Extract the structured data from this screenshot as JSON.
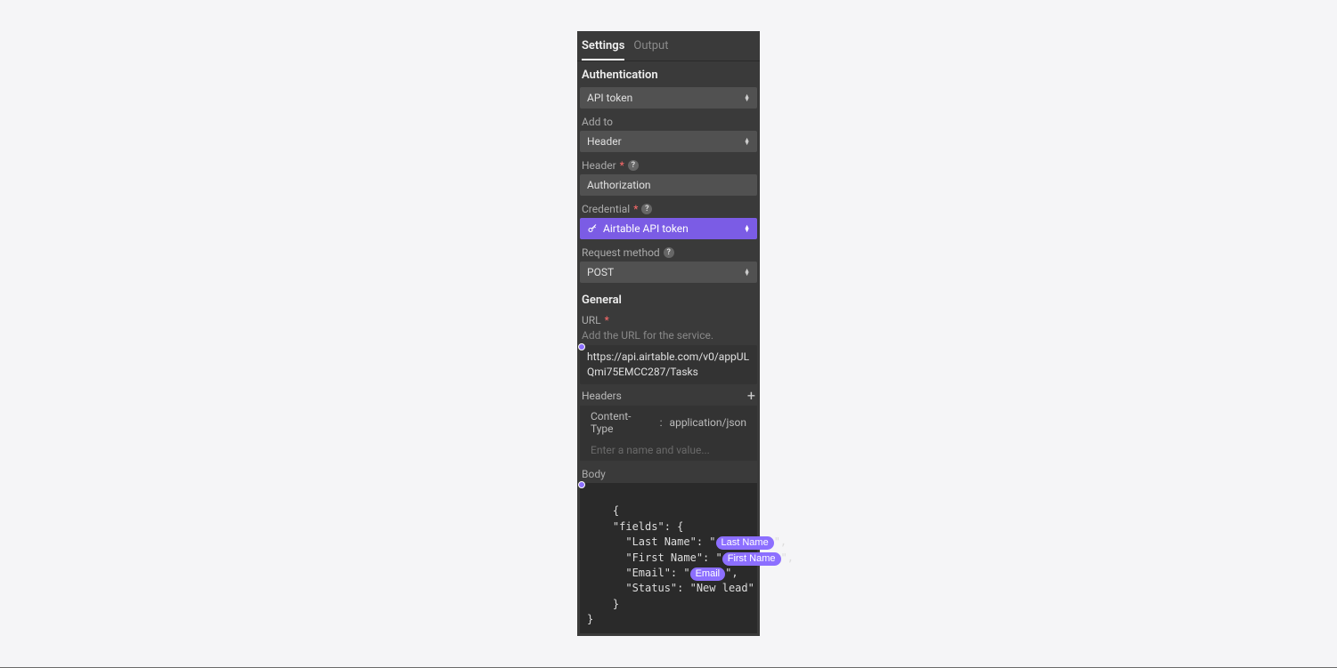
{
  "tabs": {
    "settings": "Settings",
    "output": "Output"
  },
  "auth": {
    "section": "Authentication",
    "type_value": "API token",
    "add_to_label": "Add to",
    "add_to_value": "Header",
    "header_label": "Header",
    "header_value": "Authorization",
    "credential_label": "Credential",
    "credential_value": "Airtable API token",
    "method_label": "Request method",
    "method_value": "POST"
  },
  "general": {
    "section": "General",
    "url_label": "URL",
    "url_hint": "Add the URL for the service.",
    "url_value": "https://api.airtable.com/v0/appULQmi75EMCC287/Tasks",
    "headers_label": "Headers",
    "header_key": "Content-Type",
    "header_sep": ":",
    "header_val": "application/json",
    "header_placeholder": "Enter a name and value...",
    "body_label": "Body",
    "body": {
      "l1": "{",
      "l2": "    \"fields\": {",
      "l3a": "      \"Last Name\": \"",
      "l3token": "Last Name",
      "l3b": "\",",
      "l4a": "      \"First Name\": \"",
      "l4token": "First Name",
      "l4b": "\",",
      "l5a": "      \"Email\": \"",
      "l5token": "Email",
      "l5b": "\",",
      "l6": "      \"Status\": \"New lead\"",
      "l7": "    }",
      "l8": "}"
    }
  }
}
